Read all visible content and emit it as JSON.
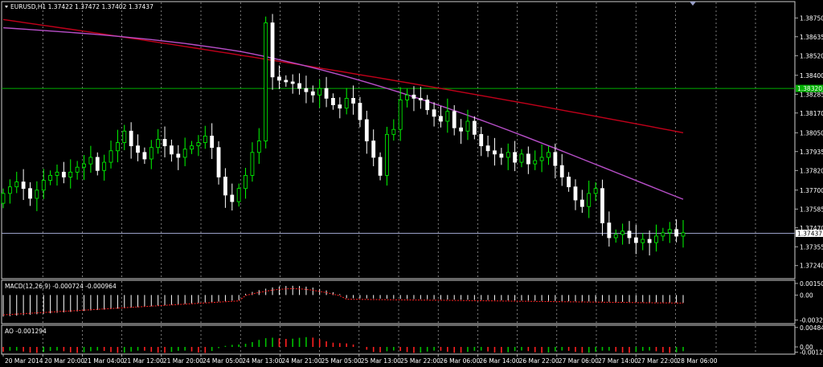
{
  "main": {
    "symbol_label": "EURUSD,H1  1.37422 1.37472 1.37402 1.37437",
    "price_ticks": [
      "1.38750",
      "1.38635",
      "1.38520",
      "1.38400",
      "1.38285",
      "1.38170",
      "1.38050",
      "1.37935",
      "1.37820",
      "1.37700",
      "1.37585",
      "1.37470",
      "1.37355",
      "1.37240"
    ],
    "highlight_price": "1.38320",
    "current_price": "1.37437",
    "y_range": [
      1.3718,
      1.3882
    ],
    "colors": {
      "up": "#00ff00",
      "down": "#ffffff",
      "ma_slow": "#c1001a",
      "ma_fast": "#b84fc9",
      "hline_green": "#00b000",
      "hline_current": "#9aa0c8",
      "grid": "#cfcfcf"
    }
  },
  "macd": {
    "label": "MACD(12,26,9) -0.000724 -0.000964",
    "ticks": [
      "0.001501",
      "0.00",
      "-0.003245"
    ],
    "y_range": [
      -0.0034,
      0.0016
    ],
    "colors": {
      "hist": "#ffffff",
      "signal": "#ff2020"
    }
  },
  "ao": {
    "label": "AO -0.001294",
    "ticks": [
      "0.004841",
      "0.00",
      "-0.001291"
    ],
    "y_range": [
      -0.0014,
      0.005
    ],
    "colors": {
      "up": "#00c000",
      "down": "#ff2020"
    }
  },
  "time_axis": [
    "20 Mar 2014",
    "20 Mar 20:00",
    "21 Mar 04:00",
    "21 Mar 12:00",
    "21 Mar 20:00",
    "24 Mar 05:00",
    "24 Mar 13:00",
    "24 Mar 21:00",
    "25 Mar 05:00",
    "25 Mar 13:00",
    "25 Mar 22:00",
    "26 Mar 06:00",
    "26 Mar 14:00",
    "26 Mar 22:00",
    "27 Mar 06:00",
    "27 Mar 14:00",
    "27 Mar 22:00",
    "28 Mar 06:00"
  ],
  "chart_data": {
    "type": "candlestick",
    "symbol": "EURUSD",
    "timeframe": "H1",
    "ohlc_last": {
      "open": 1.37422,
      "high": 1.37472,
      "low": 1.37402,
      "close": 1.37437
    },
    "close_path": [
      1.3768,
      1.3772,
      1.3775,
      1.3771,
      1.3765,
      1.377,
      1.3776,
      1.3779,
      1.3781,
      1.3778,
      1.3781,
      1.3784,
      1.3786,
      1.379,
      1.3782,
      1.3787,
      1.3794,
      1.3799,
      1.3806,
      1.3797,
      1.3793,
      1.3789,
      1.3796,
      1.3801,
      1.3797,
      1.3792,
      1.379,
      1.3795,
      1.3797,
      1.3799,
      1.3803,
      1.3796,
      1.3778,
      1.3767,
      1.3763,
      1.3771,
      1.3779,
      1.3793,
      1.38,
      1.3872,
      1.3839,
      1.3837,
      1.3836,
      1.3835,
      1.3832,
      1.383,
      1.3828,
      1.3832,
      1.3826,
      1.3822,
      1.382,
      1.3826,
      1.3823,
      1.3813,
      1.38,
      1.379,
      1.3779,
      1.3804,
      1.3807,
      1.3825,
      1.3828,
      1.3826,
      1.3825,
      1.3819,
      1.3815,
      1.3812,
      1.3818,
      1.3808,
      1.3806,
      1.3812,
      1.3804,
      1.3797,
      1.3794,
      1.3792,
      1.379,
      1.3793,
      1.3787,
      1.3792,
      1.3786,
      1.3788,
      1.379,
      1.3793,
      1.3785,
      1.3778,
      1.3772,
      1.3764,
      1.376,
      1.3768,
      1.3771,
      1.375,
      1.3741,
      1.3743,
      1.3745,
      1.3741,
      1.3738,
      1.374,
      1.3738,
      1.3742,
      1.3744,
      1.3746,
      1.3742,
      1.3744
    ],
    "ma_slow": {
      "start": 1.3874,
      "end": 1.3805
    },
    "ma_fast": {
      "start": 1.3874,
      "end": 1.377
    }
  }
}
